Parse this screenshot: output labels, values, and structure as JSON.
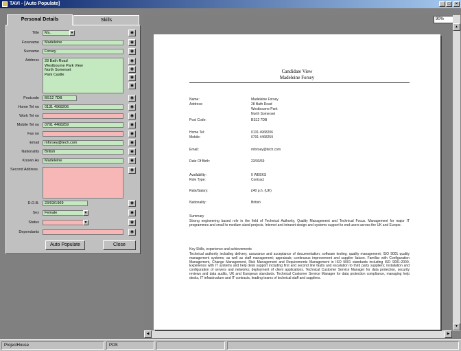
{
  "window": {
    "title": "TAVI - [Auto Populate]"
  },
  "tabs": [
    {
      "label": "Personal Details"
    },
    {
      "label": "Skills"
    }
  ],
  "form": {
    "title_label": "Title",
    "title_value": "Ms.",
    "forename_label": "Forename",
    "forename_value": "Madeleine",
    "surname_label": "Surname",
    "surname_value": "Forsey",
    "address_label": "Address",
    "address_lines": [
      "28 Bath Road",
      "Westbourne Park View",
      "North Somerset",
      "Park Castle"
    ],
    "postcode_label": "Postcode",
    "postcode_value": "BS12 7DB",
    "home_tel_label": "Home Tel no",
    "home_tel_value": "0131 4968206",
    "work_tel_label": "Work Tel no",
    "work_tel_value": "",
    "mobile_tel_label": "Mobile Tel no",
    "mobile_tel_value": "0791 4468259",
    "fax_label": "Fax no",
    "fax_value": "",
    "email_label": "Email",
    "email_value": "mforsey@tech.com",
    "nationality_label": "Nationality",
    "nationality_value": "British",
    "known_as_label": "Known As",
    "known_as_value": "Madeleine",
    "second_address_label": "Second Address",
    "dob_label": "D.O.B.",
    "dob_value": "23/03/1969",
    "sex_label": "Sex",
    "sex_value": "Female",
    "status_label": "Status",
    "status_value": "",
    "dependants_label": "Dependants",
    "dependants_value": ""
  },
  "buttons": {
    "auto_populate": "Auto Populate",
    "close": "Close"
  },
  "zoom": {
    "value": "90%"
  },
  "document": {
    "name": "Candidate View",
    "subname": "Madeleine Forsey",
    "rows": [
      {
        "label": "Name:",
        "value": "Madeleine Forsey"
      },
      {
        "label": "Address:",
        "value": "28 Bath Road"
      },
      {
        "label": "",
        "value": "Westbourne Park"
      },
      {
        "label": "",
        "value": "North Somerset"
      },
      {
        "label": "Post Code:",
        "value": "BS12 7DB"
      },
      {
        "label": "Home Tel:",
        "value": "0131 4968206"
      },
      {
        "label": "Mobile:",
        "value": "0791 4468259"
      },
      {
        "label": "Email:",
        "value": "mforsey@tech.com"
      },
      {
        "label": "Date Of Birth:",
        "value": "23/03/69"
      },
      {
        "label": "Availability:",
        "value": "0 WEEKS"
      },
      {
        "label": "Role Type:",
        "value": "Contract"
      },
      {
        "label": "Rate/Salary:",
        "value": "£40 p.h. (UK)"
      },
      {
        "label": "Nationality:",
        "value": "British"
      }
    ],
    "summary_heading": "Summary",
    "summary_text": "Strong engineering based role in the field of Technical Authority, Quality Management and Technical Focus. Management for major IT programmes and small to medium sized projects. Internet and intranet design and systems support to end users across the UK and Europe.",
    "experience_heading": "Key Skills, experience and achievements",
    "experience_text": "Technical authority including delivery, assurance and acceptance of documentation; software testing; quality management; ISO 9001 quality management systems; as well as staff management; appraisals; continuous improvement and supplier liaison. Familiar with Configuration Management, Change Management, Risk Management and Requirements Management in ISO 9001 standards including ISO 9001:2000. Experience with IT systems and help desk support including first and second line faults and escalation to third party suppliers; installation and configuration of servers and networks; deployment of client applications. Technical Customer Service Manager for data protection, security reviews and data audits, UK and European standards. Technical Customer Service Manager for data protection compliance, managing help desks, IT infrastructure and IT contracts, leading teams of technical staff and suppliers."
  },
  "statusbar": {
    "left": "ProjectHouse",
    "mid": "POS"
  }
}
